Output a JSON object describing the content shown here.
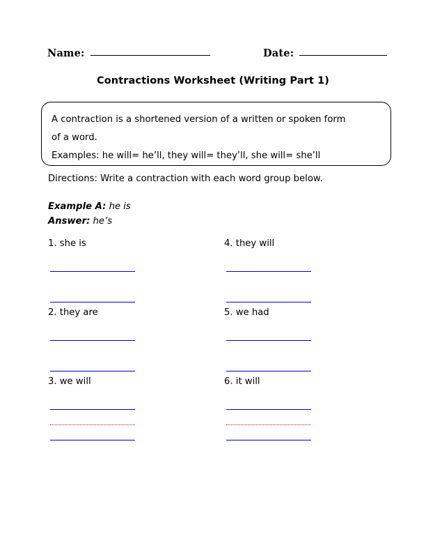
{
  "header": {
    "name_label": "Name:",
    "date_label": "Date:"
  },
  "title": "Contractions Worksheet (Writing Part 1)",
  "definition_box": {
    "lines": [
      "A contraction is a shortened version of a written or spoken form",
      "of a word.",
      "Examples: he will= he’ll, they will= they’ll, she will= she’ll"
    ]
  },
  "directions": "Directions: Write a contraction with each word group below.",
  "example": {
    "prompt_lead": "Example A:",
    "prompt_text": " he is",
    "answer_lead": "Answer:",
    "answer_text": " he’s"
  },
  "items": [
    {
      "number": "1.",
      "text": "she is",
      "label": "1. she is",
      "rule_style": "double"
    },
    {
      "number": "2.",
      "text": "they are",
      "label": "2. they are",
      "rule_style": "double"
    },
    {
      "number": "3.",
      "text": "we will",
      "label": "3. we will",
      "rule_style": "triple"
    },
    {
      "number": "4.",
      "text": "they will",
      "label": "4. they will",
      "rule_style": "double"
    },
    {
      "number": "5.",
      "text": "we had",
      "label": "5. we had",
      "rule_style": "double"
    },
    {
      "number": "6.",
      "text": "it will",
      "label": "6. it will",
      "rule_style": "triple"
    }
  ],
  "colors": {
    "rule_blue": "#0000cc",
    "rule_red": "#e01010",
    "text": "#000000",
    "page_background": "#ffffff",
    "box_border": "#000000"
  }
}
